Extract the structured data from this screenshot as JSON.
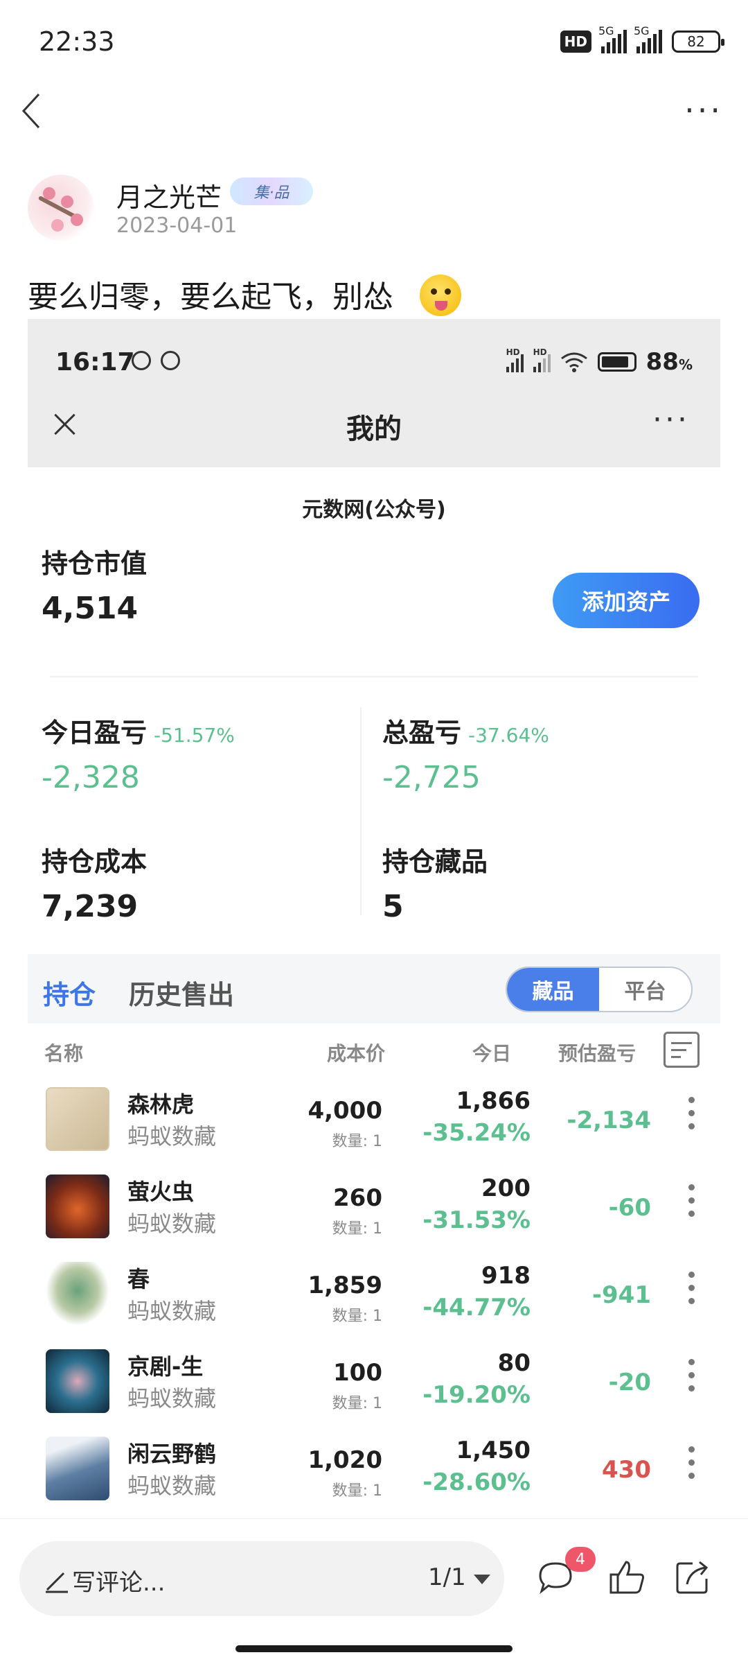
{
  "status_bar": {
    "time": "22:33",
    "hd": "HD",
    "net1": "5G",
    "net2": "5G",
    "battery": "82"
  },
  "post": {
    "author": "月之光芒",
    "author_badge": "集·品",
    "date": "2023-04-01",
    "text": "要么归零，要么起飞，别怂"
  },
  "inner": {
    "status_time": "16:17",
    "battery_pct": "88",
    "battery_unit": "%",
    "title": "我的",
    "subtitle": "元数网(公众号)",
    "market_value_label": "持仓市值",
    "market_value": "4,514",
    "add_asset_label": "添加资产",
    "today_pl_label": "今日盈亏",
    "today_pl_pct": "-51.57%",
    "today_pl": "-2,328",
    "total_pl_label": "总盈亏",
    "total_pl_pct": "-37.64%",
    "total_pl": "-2,725",
    "cost_label": "持仓成本",
    "cost": "7,239",
    "count_label": "持仓藏品",
    "count": "5",
    "tabs": [
      "持仓",
      "历史售出"
    ],
    "segment": [
      "藏品",
      "平台"
    ],
    "columns": [
      "名称",
      "成本价",
      "今日",
      "预估盈亏"
    ],
    "rows": [
      {
        "name": "森林虎",
        "platform": "蚂蚁数藏",
        "cost": "4,000",
        "qty": "数量: 1",
        "today": "1,866",
        "change": "-35.24%",
        "pl": "-2,134"
      },
      {
        "name": "萤火虫",
        "platform": "蚂蚁数藏",
        "cost": "260",
        "qty": "数量: 1",
        "today": "200",
        "change": "-31.53%",
        "pl": "-60"
      },
      {
        "name": "春",
        "platform": "蚂蚁数藏",
        "cost": "1,859",
        "qty": "数量: 1",
        "today": "918",
        "change": "-44.77%",
        "pl": "-941"
      },
      {
        "name": "京剧-生",
        "platform": "蚂蚁数藏",
        "cost": "100",
        "qty": "数量: 1",
        "today": "80",
        "change": "-19.20%",
        "pl": "-20"
      },
      {
        "name": "闲云野鹤",
        "platform": "蚂蚁数藏",
        "cost": "1,020",
        "qty": "数量: 1",
        "today": "1,450",
        "change": "-28.60%",
        "pl": "430"
      }
    ]
  },
  "bottom": {
    "comment_placeholder": "写评论...",
    "pager": "1/1",
    "comment_count": "4"
  },
  "colors": {
    "accent": "#3d76e6",
    "loss": "#5cbf8f",
    "gain": "#d9534f"
  }
}
